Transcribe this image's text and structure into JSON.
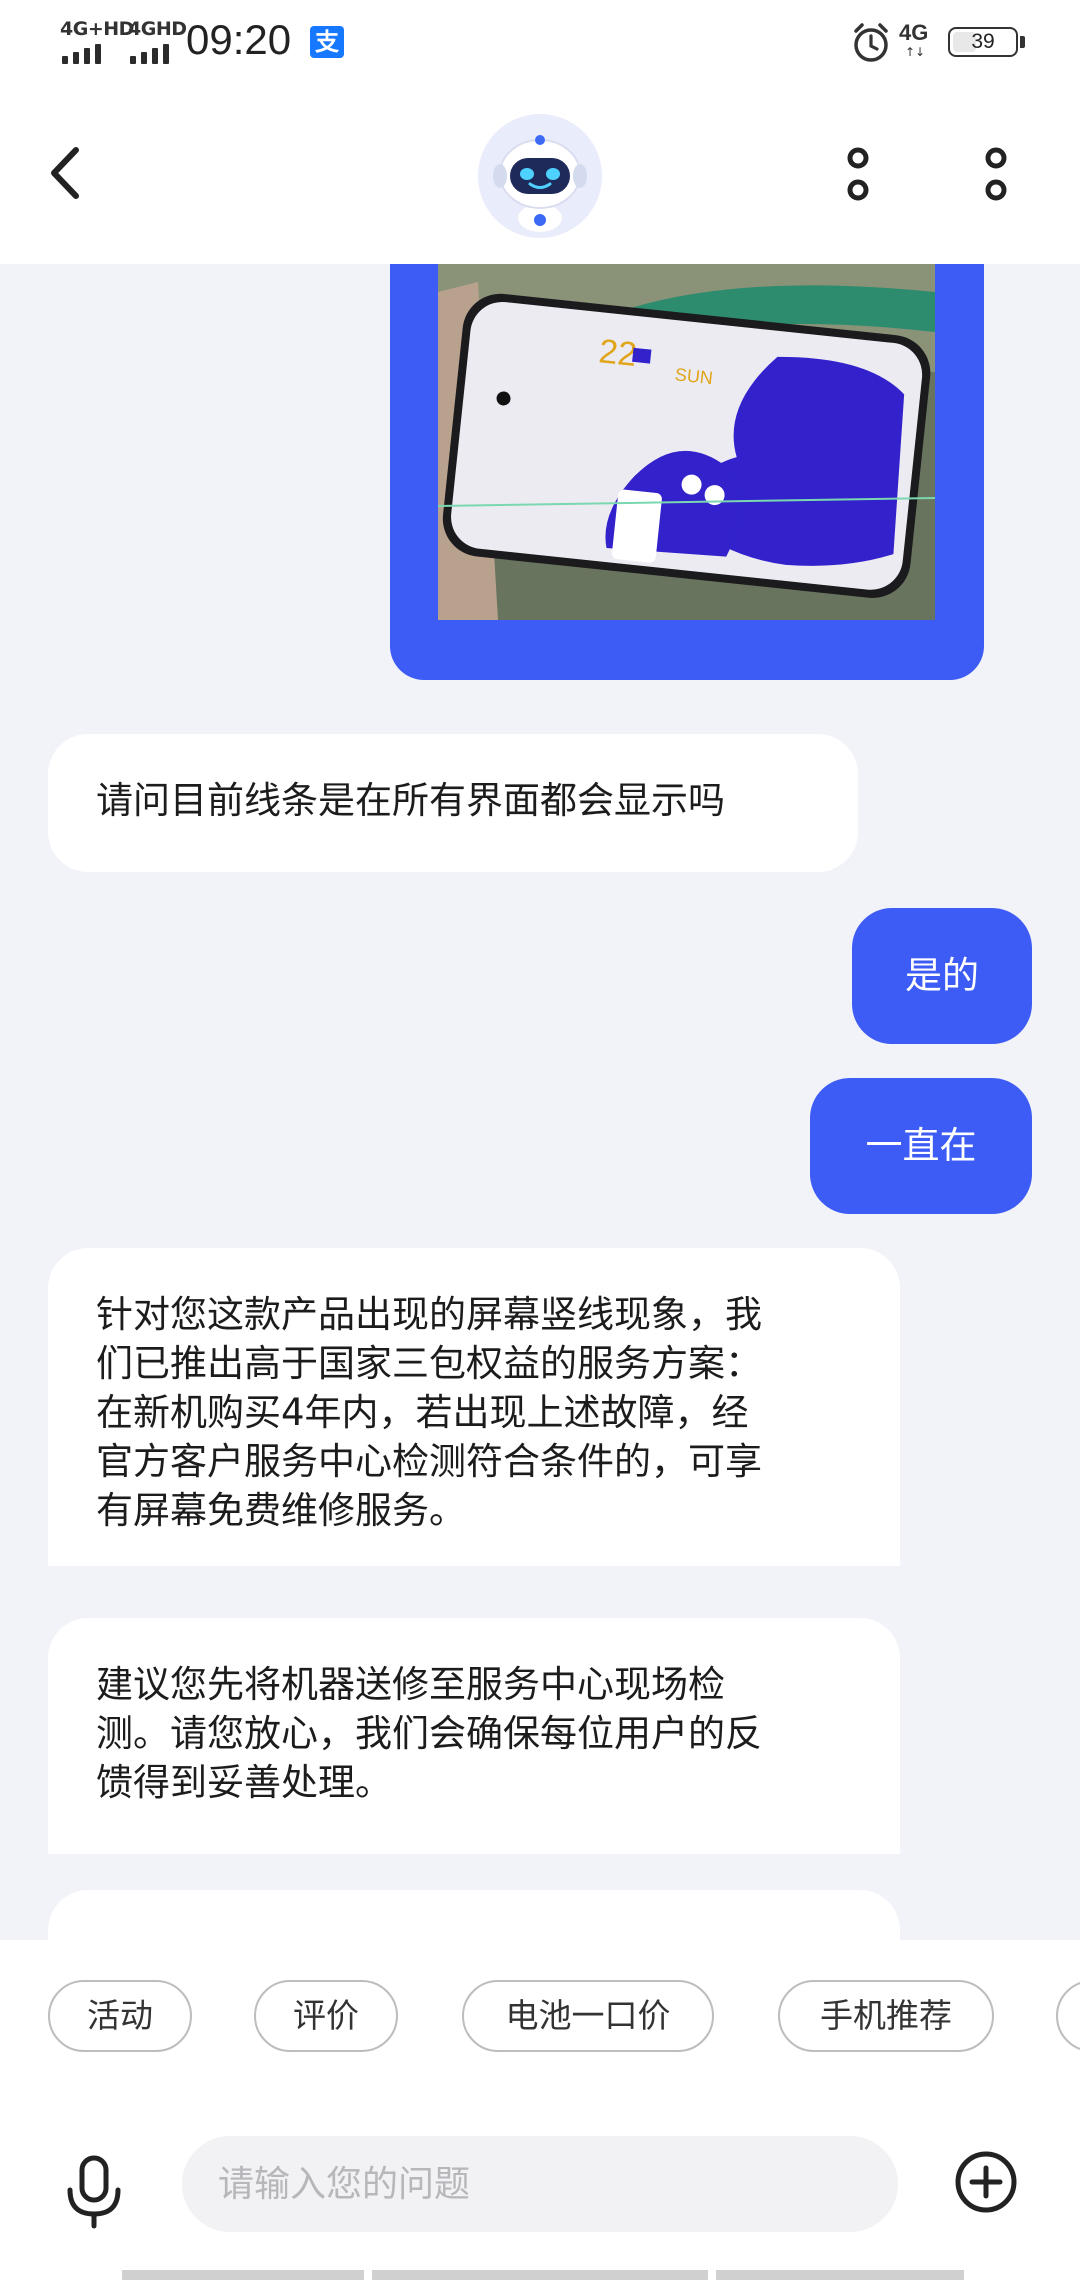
{
  "status_bar": {
    "signal1_label": "4G+HD",
    "signal2_label": "4GHD",
    "time": "09:20",
    "pay_glyph": "支",
    "alarm_icon": "alarm-clock-icon",
    "network_label": "4G",
    "network_arrows": "↑↓",
    "battery_percent": "39"
  },
  "header": {
    "back_icon": "chevron-left-icon",
    "avatar_icon": "robot-assistant-icon",
    "more_icons": [
      "more-vertical-icon",
      "more-vertical-icon"
    ]
  },
  "messages": [
    {
      "from": "user",
      "type": "image",
      "description_icon": "phone-photo-image"
    },
    {
      "from": "bot",
      "text": "请问目前线条是在所有界面都会显示吗"
    },
    {
      "from": "user",
      "text": "是的"
    },
    {
      "from": "user",
      "text": "一直在"
    },
    {
      "from": "bot",
      "lines": [
        "针对您这款产品出现的屏幕竖线现象，我",
        "们已推出高于国家三包权益的服务方案：",
        "在新机购买4年内，若出现上述故障，经",
        "官方客户服务中心检测符合条件的，可享",
        "有屏幕免费维修服务。"
      ]
    },
    {
      "from": "bot",
      "lines": [
        "建议您先将机器送修至服务中心现场检",
        "测。请您放心，我们会确保每位用户的反",
        "馈得到妥善处理。"
      ]
    }
  ],
  "quick_chips": [
    "活动",
    "评价",
    "电池一口价",
    "手机推荐"
  ],
  "input": {
    "placeholder": "请输入您的问题",
    "value": "",
    "mic_icon": "microphone-icon",
    "add_icon": "plus-circle-icon"
  },
  "colors": {
    "accent": "#3d5cf5",
    "background": "#f1f3f8",
    "bubble_bot": "#ffffff"
  }
}
